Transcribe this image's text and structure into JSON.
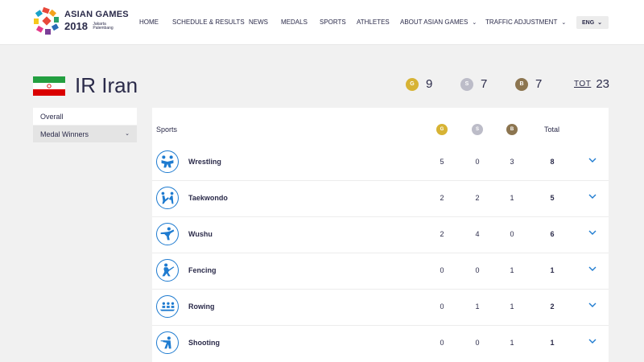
{
  "header": {
    "logo_title": "ASIAN GAMES",
    "logo_year": "2018",
    "logo_sub": "Jakarta Palembang",
    "nav": [
      {
        "label": "HOME",
        "has_dropdown": false
      },
      {
        "label": "SCHEDULE & RESULTS",
        "has_dropdown": false
      },
      {
        "label": "NEWS",
        "has_dropdown": false
      },
      {
        "label": "MEDALS",
        "has_dropdown": false
      },
      {
        "label": "SPORTS",
        "has_dropdown": false
      },
      {
        "label": "ATHLETES",
        "has_dropdown": false
      },
      {
        "label": "ABOUT ASIAN GAMES",
        "has_dropdown": true
      },
      {
        "label": "TRAFFIC ADJUSTMENT",
        "has_dropdown": true
      }
    ],
    "language": "ENG"
  },
  "country": {
    "name": "IR Iran",
    "flag_colors": {
      "green": "#239f40",
      "white": "#ffffff",
      "red": "#da0000"
    }
  },
  "summary": {
    "gold_label": "G",
    "gold": "9",
    "silver_label": "S",
    "silver": "7",
    "bronze_label": "B",
    "bronze": "7",
    "total_label": "TOT",
    "total": "23"
  },
  "sidebar": {
    "items": [
      {
        "label": "Overall",
        "active": true
      },
      {
        "label": "Medal Winners",
        "active": false,
        "has_dropdown": true
      }
    ]
  },
  "table": {
    "headers": {
      "sports": "Sports",
      "gold": "G",
      "silver": "S",
      "bronze": "B",
      "total": "Total"
    },
    "rows": [
      {
        "sport": "Wrestling",
        "icon": "wrestling-icon",
        "gold": "5",
        "silver": "0",
        "bronze": "3",
        "total": "8"
      },
      {
        "sport": "Taekwondo",
        "icon": "taekwondo-icon",
        "gold": "2",
        "silver": "2",
        "bronze": "1",
        "total": "5"
      },
      {
        "sport": "Wushu",
        "icon": "wushu-icon",
        "gold": "2",
        "silver": "4",
        "bronze": "0",
        "total": "6"
      },
      {
        "sport": "Fencing",
        "icon": "fencing-icon",
        "gold": "0",
        "silver": "0",
        "bronze": "1",
        "total": "1"
      },
      {
        "sport": "Rowing",
        "icon": "rowing-icon",
        "gold": "0",
        "silver": "1",
        "bronze": "1",
        "total": "2"
      },
      {
        "sport": "Shooting",
        "icon": "shooting-icon",
        "gold": "0",
        "silver": "0",
        "bronze": "1",
        "total": "1"
      }
    ]
  },
  "colors": {
    "navy_text": "#2b2b4a",
    "accent_blue": "#1e7bd0",
    "gold": "#d7b334",
    "silver": "#bcbcc8",
    "bronze": "#8c7550",
    "background": "#f1f1f1"
  }
}
